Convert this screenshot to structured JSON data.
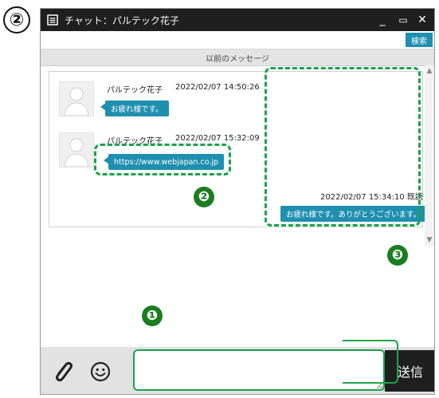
{
  "step_marker": "②",
  "window": {
    "title": "チャット：パルテック花子",
    "minimize_glyph": "_",
    "maximize_glyph": "▭",
    "close_glyph": "✕"
  },
  "search": {
    "button_label": "検索",
    "placeholder": ""
  },
  "history": {
    "previous_label": "以前のメッセージ"
  },
  "messages": [
    {
      "sender": "パルテック花子",
      "timestamp": "2022/02/07 14:50:26",
      "text": "お疲れ様です。"
    },
    {
      "sender": "パルテック花子",
      "timestamp": "2022/02/07 15:32:09",
      "text": "https://www.webjapan.co.jp"
    }
  ],
  "outgoing": {
    "meta": "2022/02/07 15:34:10 既読",
    "text": "お疲れ様です。ありがとうございます。"
  },
  "callouts": {
    "one": "❶",
    "two": "❷",
    "three": "❸"
  },
  "composer": {
    "placeholder": "",
    "value": "",
    "send_label": "送信"
  },
  "colors": {
    "accent": "#1f8fb0",
    "highlight": "#19a34a",
    "titlebar": "#1f1f1f",
    "badge": "#1a7d1f"
  },
  "icons": {
    "attach": "paperclip-icon",
    "emoji": "smiley-icon",
    "app": "chat-window-icon"
  }
}
